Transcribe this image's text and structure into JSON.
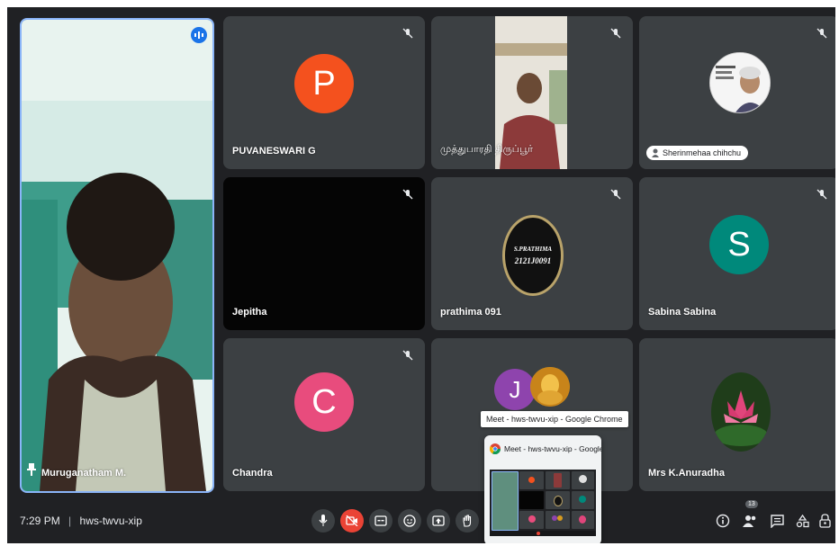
{
  "tiles": [
    {
      "name": "Muruganatham M."
    },
    {
      "name": "PUVANESWARI G",
      "initial": "P"
    },
    {
      "name": "முத்துபாரதி திருப்பூர்"
    },
    {
      "name": "Sherinmehaa chihchu"
    },
    {
      "name": "Jepitha"
    },
    {
      "name": "prathima 091",
      "badge_line1": "S.PRATHIMA",
      "badge_line2": "2121J0091"
    },
    {
      "name": "Sabina Sabina",
      "initial": "S"
    },
    {
      "name": "Chandra",
      "initial": "C"
    },
    {
      "name": "",
      "initial": "J"
    },
    {
      "name": "Mrs K.Anuradha"
    }
  ],
  "bottom_bar": {
    "time": "7:29 PM",
    "separator": "|",
    "meeting_code": "hws-twvu-xip",
    "participant_count": "13"
  },
  "taskbar_preview": {
    "tooltip": "Meet - hws-twvu-xip - Google Chrome",
    "title": "Meet - hws-twvu-xip - Google ..."
  },
  "colors": {
    "background": "#202124",
    "tile": "#3c4043",
    "avatar_p": "#f4511e",
    "avatar_s": "#00897b",
    "avatar_c": "#e84c7d",
    "avatar_j": "#8e44ad",
    "end_red": "#ea4335",
    "active_border": "#8ab4f8"
  }
}
